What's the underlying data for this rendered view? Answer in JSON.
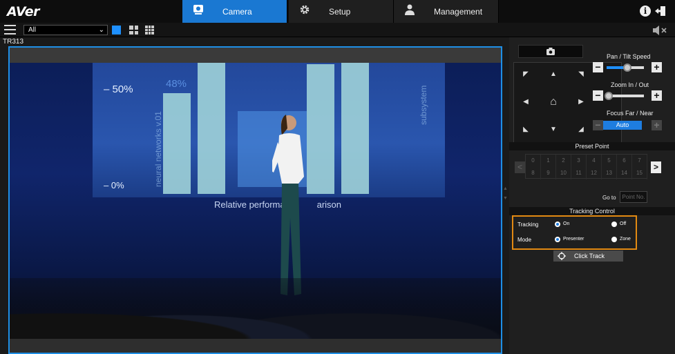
{
  "header": {
    "logo": "AVer",
    "tabs": [
      {
        "label": "Camera",
        "icon": "camera-icon",
        "active": true
      },
      {
        "label": "Setup",
        "icon": "gear-icon",
        "active": false
      },
      {
        "label": "Management",
        "icon": "user-icon",
        "active": false
      }
    ]
  },
  "toolbar": {
    "camera_select": "All",
    "layouts": [
      "single-view-icon",
      "quad-view-icon",
      "nine-view-icon"
    ]
  },
  "camera": {
    "name": "TR313",
    "scene_text": {
      "pct_50": "– 50%",
      "pct_48": "48%",
      "pct_0": "– 0%",
      "caption": "Relative performa",
      "caption_tail": "arison",
      "vertical_left": "neural networks v.01",
      "vertical_right": "subsystem"
    }
  },
  "panel": {
    "pan_tilt_label": "Pan / Tilt Speed",
    "pan_tilt_level": 0.55,
    "zoom_label": "Zoom In / Out",
    "zoom_level": 0.05,
    "focus_label": "Focus Far / Near",
    "focus_mode": "Auto",
    "preset_title": "Preset Point",
    "presets_row1": [
      "0",
      "1",
      "2",
      "3",
      "4",
      "5",
      "6",
      "7"
    ],
    "presets_row2": [
      "8",
      "9",
      "10",
      "11",
      "12",
      "13",
      "14",
      "15"
    ],
    "goto_label": "Go to",
    "goto_placeholder": "Point No.",
    "tracking_title": "Tracking Control",
    "tracking_label": "Tracking",
    "tracking_on": "On",
    "tracking_off": "Off",
    "mode_label": "Mode",
    "mode_presenter": "Presenter",
    "mode_zone": "Zone",
    "click_track": "Click Track"
  },
  "colors": {
    "accent": "#1e7de0",
    "highlight": "#e38a12"
  }
}
